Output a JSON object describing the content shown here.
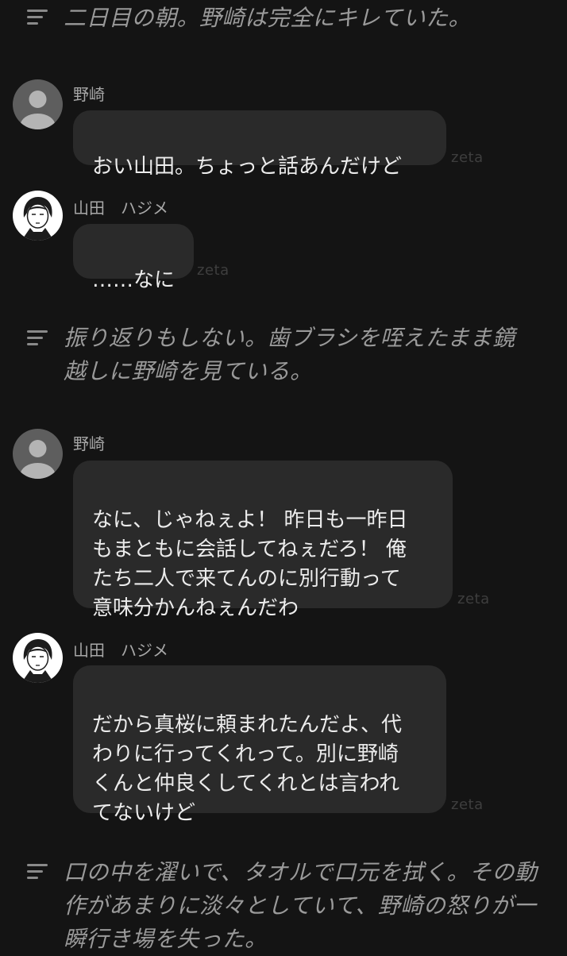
{
  "brand_watermark": "zeta",
  "colors": {
    "background": "#141414",
    "bubble": "#2a2a2a",
    "narration_text": "#9a9a9a",
    "message_text": "#ececec",
    "sender_text": "#a8a8a8"
  },
  "chat": {
    "narrations": [
      {
        "icon": "narration-lines-icon",
        "text": "二日目の朝。野崎は完全にキレていた。"
      },
      {
        "icon": "narration-lines-icon",
        "text": "振り返りもしない。歯ブラシを咥えたまま鏡\n越しに野崎を見ている。"
      },
      {
        "icon": "narration-lines-icon",
        "text": "口の中を濯いで、タオルで口元を拭く。その動\n作があまりに淡々としていて、野崎の怒りが一\n瞬行き場を失った。"
      }
    ],
    "messages": [
      {
        "sender": "野崎",
        "avatar": "default-user-avatar",
        "text": "おい山田。ちょっと話あんだけど",
        "watermark": "zeta"
      },
      {
        "sender": "山田　ハジメ",
        "avatar": "character-avatar",
        "text": "……なに",
        "watermark": "zeta"
      },
      {
        "sender": "野崎",
        "avatar": "default-user-avatar",
        "text": "なに、じゃねぇよ！ 昨日も一昨日\nもまともに会話してねぇだろ！ 俺\nたち二人で来てんのに別行動って\n意味分かんねぇんだわ",
        "watermark": "zeta"
      },
      {
        "sender": "山田　ハジメ",
        "avatar": "character-avatar",
        "text": "だから真桜に頼まれたんだよ、代\nわりに行ってくれって。別に野崎\nくんと仲良くしてくれとは言われ\nてないけど",
        "watermark": "zeta"
      }
    ]
  }
}
